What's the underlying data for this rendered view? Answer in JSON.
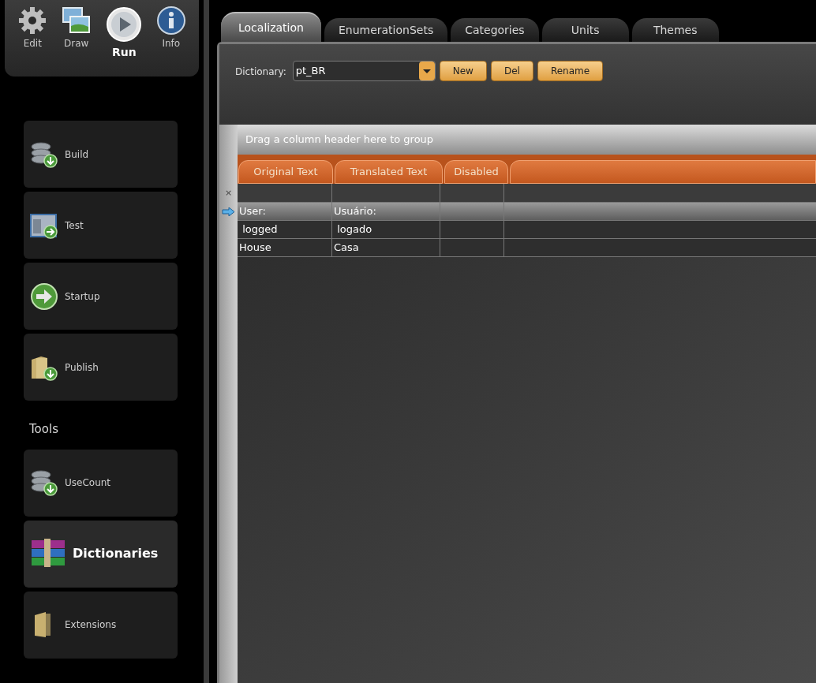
{
  "toolbar": [
    {
      "kind": "gear",
      "label": "Edit",
      "selected": false
    },
    {
      "kind": "pictures",
      "label": "Draw",
      "selected": false
    },
    {
      "kind": "play",
      "label": "Run",
      "selected": true
    },
    {
      "kind": "info",
      "label": "Info",
      "selected": false
    }
  ],
  "sidebar": {
    "items": [
      {
        "kind": "database",
        "label": "Build",
        "selected": false
      },
      {
        "kind": "window",
        "label": "Test",
        "selected": false
      },
      {
        "kind": "arrow",
        "label": "Startup",
        "selected": false
      },
      {
        "kind": "folder",
        "label": "Publish",
        "selected": false
      }
    ],
    "tools_heading": "Tools",
    "tools": [
      {
        "kind": "database",
        "label": "UseCount",
        "selected": false
      },
      {
        "kind": "books",
        "label": "Dictionaries",
        "selected": true
      },
      {
        "kind": "door",
        "label": "Extensions",
        "selected": false
      }
    ]
  },
  "tabs": [
    {
      "label": "Localization",
      "selected": true
    },
    {
      "label": "EnumerationSets",
      "selected": false
    },
    {
      "label": "Categories",
      "selected": false
    },
    {
      "label": "Units",
      "selected": false
    },
    {
      "label": "Themes",
      "selected": false
    }
  ],
  "dictionary": {
    "label": "Dictionary:",
    "value": "pt_BR",
    "buttons": [
      "New",
      "Del",
      "Rename"
    ]
  },
  "grid": {
    "group_hint": "Drag a column header here to group",
    "new_row_marker": "×",
    "columns": [
      "Original Text",
      "Translated Text",
      "Disabled"
    ],
    "rows": [
      {
        "original": "User:",
        "translated": "Usuário:",
        "selected": true
      },
      {
        "original": " logged",
        "translated": " logado",
        "selected": false
      },
      {
        "original": "House",
        "translated": "Casa",
        "selected": false
      }
    ]
  }
}
